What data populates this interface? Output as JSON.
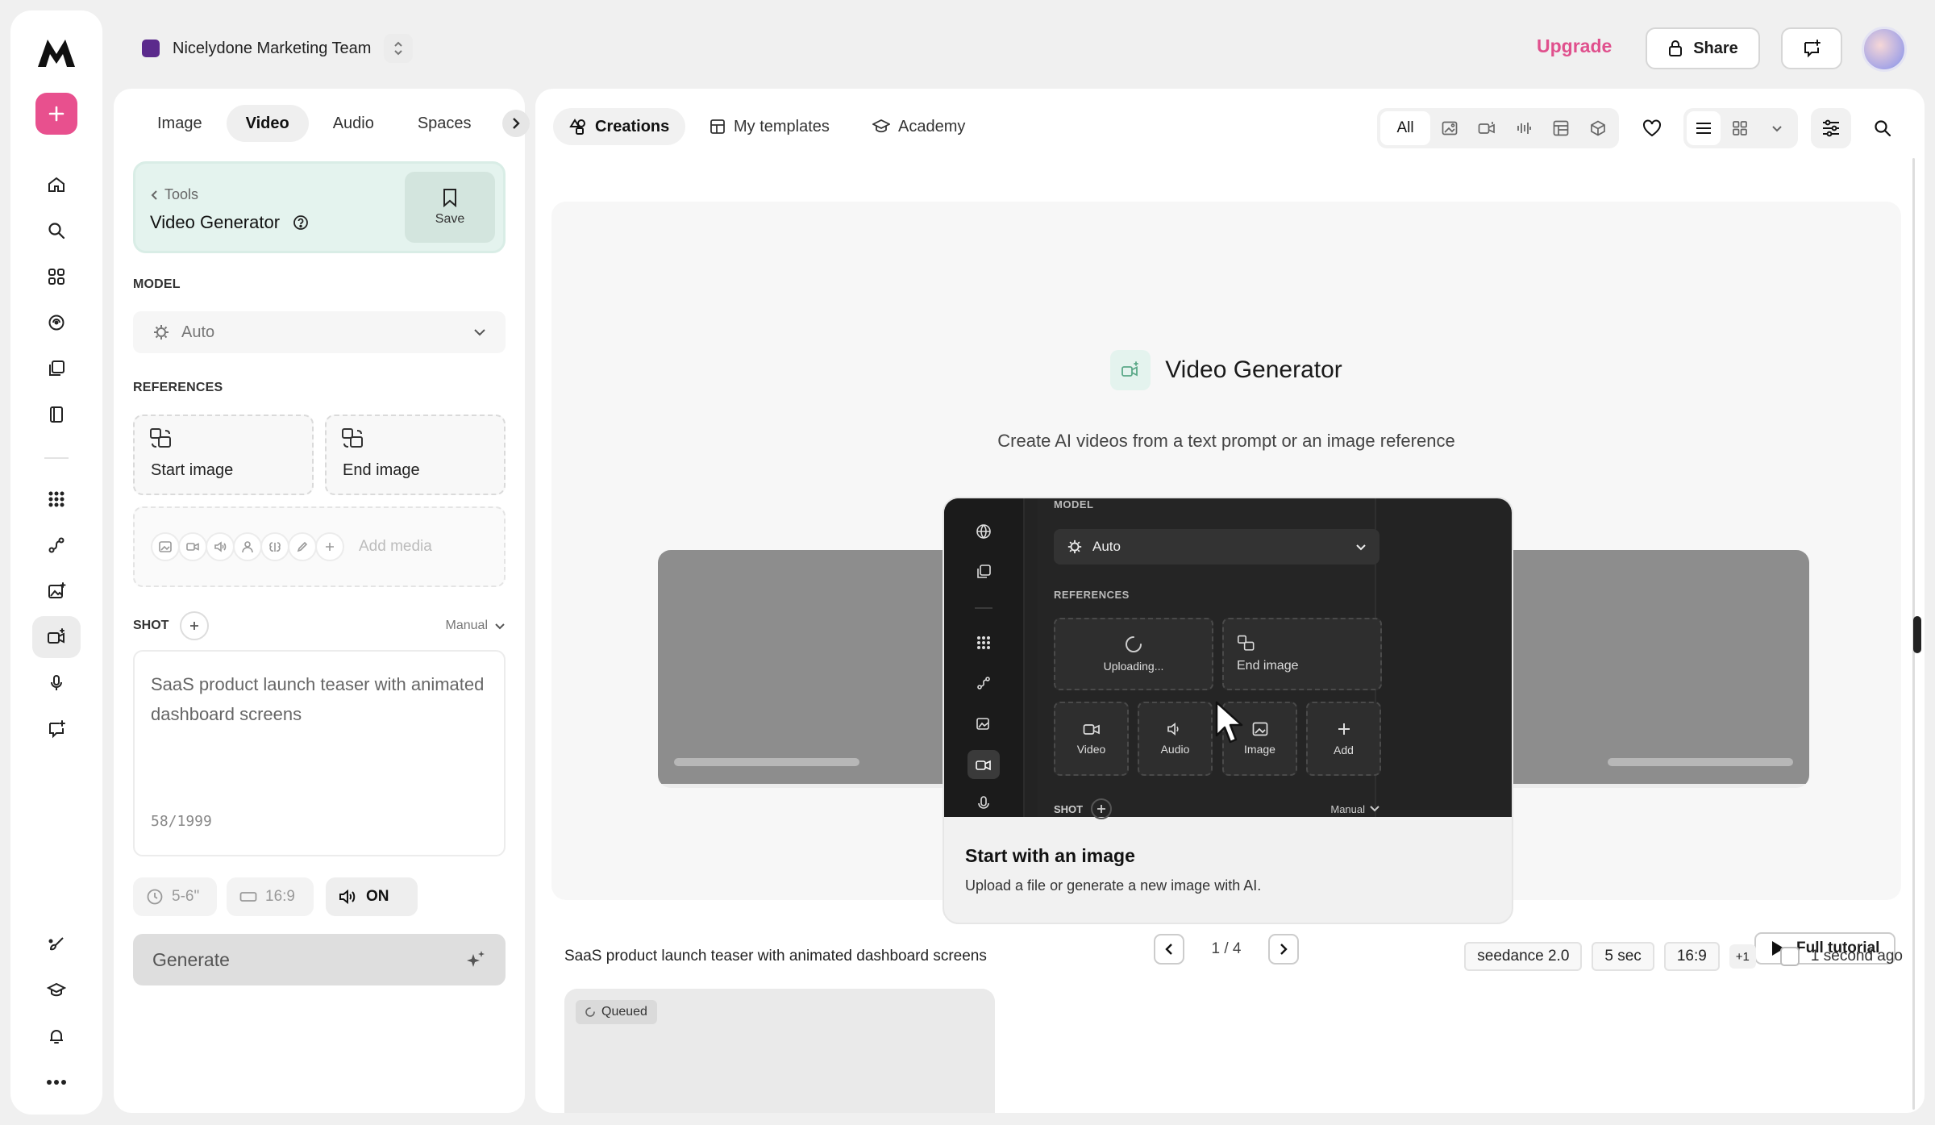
{
  "workspace": {
    "name": "Nicelydone Marketing Team",
    "swatch_color": "#5b2a8c"
  },
  "topbar": {
    "upgrade_label": "Upgrade",
    "share_label": "Share"
  },
  "left_panel": {
    "tabs": [
      "Image",
      "Video",
      "Audio",
      "Spaces"
    ],
    "active_tab": "Video",
    "tool": {
      "back_label": "Tools",
      "name": "Video Generator",
      "save_label": "Save"
    },
    "model": {
      "label": "MODEL",
      "value": "Auto"
    },
    "references": {
      "label": "REFERENCES",
      "start_image": "Start image",
      "end_image": "End image",
      "add_media_placeholder": "Add media"
    },
    "shot": {
      "label": "SHOT",
      "mode": "Manual"
    },
    "prompt": {
      "text": "SaaS product launch teaser with animated dashboard screens",
      "count": "58/1999"
    },
    "settings": {
      "duration": "5-6\"",
      "aspect": "16:9",
      "audio": "ON"
    },
    "generate_label": "Generate"
  },
  "main": {
    "tabs": [
      "Creations",
      "My templates",
      "Academy"
    ],
    "active_tab": "Creations",
    "filters": {
      "all_label": "All",
      "icons": [
        "image-icon",
        "video-icon",
        "audio-icon",
        "board-icon",
        "cube-icon"
      ]
    },
    "hero": {
      "title": "Video Generator",
      "subtitle": "Create AI videos from a text prompt or an image reference",
      "slide": {
        "model_label": "MODEL",
        "model_value": "Auto",
        "references_label": "REFERENCES",
        "uploading": "Uploading...",
        "end_image": "End image",
        "video": "Video",
        "audio": "Audio",
        "image": "Image",
        "add": "Add",
        "shot_label": "SHOT",
        "shot_mode": "Manual",
        "title": "Start with an image",
        "description": "Upload a file or generate a new image with AI."
      },
      "pager": "1 / 4",
      "tutorial_label": "Full tutorial"
    },
    "generation": {
      "prompt": "SaaS product launch teaser with animated dashboard screens",
      "tags": [
        "seedance 2.0",
        "5 sec",
        "16:9"
      ],
      "extra_tag": "+1",
      "time": "1 second ago",
      "status": "Queued"
    }
  },
  "colors": {
    "accent_pink": "#e0508d",
    "mint": "#e4f3ee",
    "new_button": "#e8508e"
  }
}
